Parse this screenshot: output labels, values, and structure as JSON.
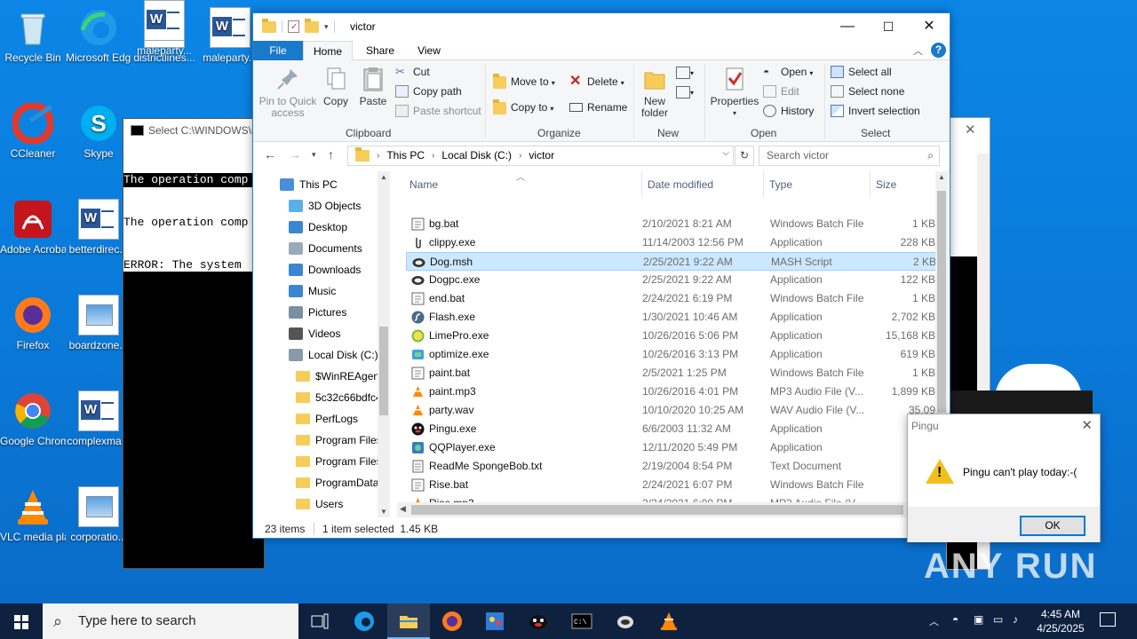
{
  "desktop": {
    "icons_col1": [
      {
        "label": "Recycle Bin",
        "icon": "recycle-bin-icon"
      },
      {
        "label": "CCleaner",
        "icon": "ccleaner-icon"
      },
      {
        "label": "Adobe Acrobat",
        "icon": "adobe-acrobat-icon"
      },
      {
        "label": "Firefox",
        "icon": "firefox-icon"
      },
      {
        "label": "Google Chrome",
        "icon": "chrome-icon"
      },
      {
        "label": "VLC media player",
        "icon": "vlc-icon"
      }
    ],
    "icons_col2": [
      {
        "label": "Microsoft Edge",
        "icon": "edge-icon"
      },
      {
        "label": "Skype",
        "icon": "skype-icon"
      },
      {
        "label": "betterdirec...",
        "icon": "word-doc-icon"
      },
      {
        "label": "boardzone...",
        "icon": "image-file-icon"
      },
      {
        "label": "complexma...",
        "icon": "word-doc-icon"
      },
      {
        "label": "corporatio...",
        "icon": "image-file-icon"
      }
    ],
    "icons_col3": [
      {
        "label": "districtlines...",
        "icon": "word-doc-icon"
      },
      {
        "label": "maleparty...",
        "icon": "word-doc-icon"
      }
    ]
  },
  "console": {
    "title": "Select C:\\WINDOWS\\s",
    "lines": [
      "The operation comp",
      "The operation comp",
      "ERROR: The system"
    ]
  },
  "explorer": {
    "title": "victor",
    "tabs": [
      "File",
      "Home",
      "Share",
      "View"
    ],
    "ribbon": {
      "clipboard": {
        "pin": "Pin to Quick access",
        "copy": "Copy",
        "paste": "Paste",
        "cut": "Cut",
        "copy_path": "Copy path",
        "paste_shortcut": "Paste shortcut",
        "group": "Clipboard"
      },
      "organize": {
        "move_to": "Move to",
        "copy_to": "Copy to",
        "delete": "Delete",
        "rename": "Rename",
        "group": "Organize"
      },
      "new": {
        "new_folder": "New folder",
        "group": "New"
      },
      "open": {
        "properties": "Properties",
        "open": "Open",
        "edit": "Edit",
        "history": "History",
        "group": "Open"
      },
      "select": {
        "select_all": "Select all",
        "select_none": "Select none",
        "invert": "Invert selection",
        "group": "Select"
      }
    },
    "address": [
      "This PC",
      "Local Disk (C:)",
      "victor"
    ],
    "search_placeholder": "Search victor",
    "nav": [
      {
        "label": "This PC",
        "level": 0
      },
      {
        "label": "3D Objects",
        "level": 1
      },
      {
        "label": "Desktop",
        "level": 1
      },
      {
        "label": "Documents",
        "level": 1
      },
      {
        "label": "Downloads",
        "level": 1
      },
      {
        "label": "Music",
        "level": 1
      },
      {
        "label": "Pictures",
        "level": 1
      },
      {
        "label": "Videos",
        "level": 1
      },
      {
        "label": "Local Disk (C:)",
        "level": 1
      },
      {
        "label": "$WinREAgent",
        "level": 2
      },
      {
        "label": "5c32c66bdfc4",
        "level": 2
      },
      {
        "label": "PerfLogs",
        "level": 2
      },
      {
        "label": "Program Files",
        "level": 2
      },
      {
        "label": "Program Files",
        "level": 2
      },
      {
        "label": "ProgramData",
        "level": 2
      },
      {
        "label": "Users",
        "level": 2
      }
    ],
    "columns": [
      "Name",
      "Date modified",
      "Type",
      "Size"
    ],
    "files": [
      {
        "name": "bg.bat",
        "date": "2/10/2021 8:21 AM",
        "type": "Windows Batch File",
        "size": "1 KB",
        "icon": "bat"
      },
      {
        "name": "clippy.exe",
        "date": "11/14/2003 12:56 PM",
        "type": "Application",
        "size": "228 KB",
        "icon": "clippy"
      },
      {
        "name": "Dog.msh",
        "date": "2/25/2021 9:22 AM",
        "type": "MASH Script",
        "size": "2 KB",
        "icon": "dog",
        "selected": true
      },
      {
        "name": "Dogpc.exe",
        "date": "2/25/2021 9:22 AM",
        "type": "Application",
        "size": "122 KB",
        "icon": "dog"
      },
      {
        "name": "end.bat",
        "date": "2/24/2021 6:19 PM",
        "type": "Windows Batch File",
        "size": "1 KB",
        "icon": "bat"
      },
      {
        "name": "Flash.exe",
        "date": "1/30/2021 10:46 AM",
        "type": "Application",
        "size": "2,702 KB",
        "icon": "flash"
      },
      {
        "name": "LimePro.exe",
        "date": "10/26/2016 5:06 PM",
        "type": "Application",
        "size": "15,168 KB",
        "icon": "lime"
      },
      {
        "name": "optimize.exe",
        "date": "10/26/2016 3:13 PM",
        "type": "Application",
        "size": "619 KB",
        "icon": "optimize"
      },
      {
        "name": "paint.bat",
        "date": "2/5/2021 1:25 PM",
        "type": "Windows Batch File",
        "size": "1 KB",
        "icon": "bat"
      },
      {
        "name": "paint.mp3",
        "date": "10/26/2016 4:01 PM",
        "type": "MP3 Audio File (V...",
        "size": "1,899 KB",
        "icon": "vlc"
      },
      {
        "name": "party.wav",
        "date": "10/10/2020 10:25 AM",
        "type": "WAV Audio File (V...",
        "size": "35,09",
        "icon": "vlc"
      },
      {
        "name": "Pingu.exe",
        "date": "6/6/2003 11:32 AM",
        "type": "Application",
        "size": "9",
        "icon": "pingu"
      },
      {
        "name": "QQPlayer.exe",
        "date": "12/11/2020 5:49 PM",
        "type": "Application",
        "size": "34,8",
        "icon": "qq"
      },
      {
        "name": "ReadMe SpongeBob.txt",
        "date": "2/19/2004 8:54 PM",
        "type": "Text Document",
        "size": "",
        "icon": "txt"
      },
      {
        "name": "Rise.bat",
        "date": "2/24/2021 6:07 PM",
        "type": "Windows Batch File",
        "size": "",
        "icon": "bat"
      },
      {
        "name": "Rise.mp3",
        "date": "2/24/2021 6:00 PM",
        "type": "MP3 Audio File (V...",
        "size": "3,5",
        "icon": "vlc"
      }
    ],
    "status": {
      "count": "23 items",
      "selected": "1 item selected  1.45 KB"
    }
  },
  "dialog": {
    "title": "Pingu",
    "message": "Pingu can't play today:-(",
    "ok": "OK"
  },
  "watermark": "ANY RUN",
  "taskbar": {
    "search_placeholder": "Type here to search",
    "time": "4:45 AM",
    "date": "4/25/2025"
  }
}
